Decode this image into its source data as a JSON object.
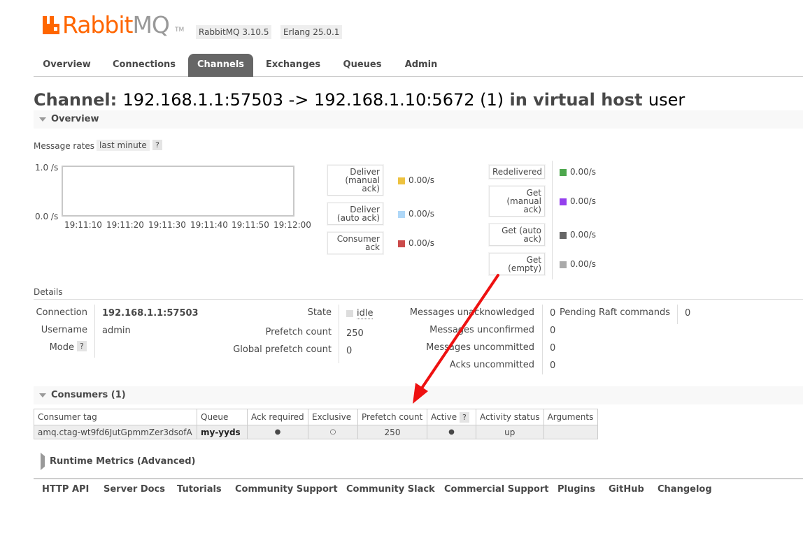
{
  "header": {
    "logo_text_rabbit": "Rabbit",
    "logo_text_mq": "MQ",
    "logo_tm": "TM",
    "rabbitmq_version": "RabbitMQ 3.10.5",
    "erlang_version": "Erlang 25.0.1",
    "brand_color": "#ff6600"
  },
  "tabs": [
    {
      "label": "Overview"
    },
    {
      "label": "Connections"
    },
    {
      "label": "Channels",
      "active": true
    },
    {
      "label": "Exchanges"
    },
    {
      "label": "Queues"
    },
    {
      "label": "Admin"
    }
  ],
  "title": {
    "prefix": "Channel: ",
    "channel": "192.168.1.1:57503 -> 192.168.1.10:5672 (1)",
    "middle": " in virtual host ",
    "vhost": "user"
  },
  "overview": {
    "heading": "Overview",
    "rates_label": "Message rates",
    "rates_window": "last minute",
    "help": "?",
    "chart": {
      "y_ticks": [
        "1.0 /s",
        "0.0 /s"
      ],
      "x_ticks": [
        "19:11:10",
        "19:11:20",
        "19:11:30",
        "19:11:40",
        "19:11:50",
        "19:12:00"
      ]
    },
    "rates_left": [
      {
        "label_lines": [
          "Deliver",
          "(manual",
          "ack)"
        ],
        "value": "0.00/s",
        "color": "#edc240"
      },
      {
        "label_lines": [
          "Deliver",
          "(auto ack)"
        ],
        "value": "0.00/s",
        "color": "#afd8f8"
      },
      {
        "label_lines": [
          "Consumer",
          "ack"
        ],
        "value": "0.00/s",
        "color": "#cb4b4b"
      }
    ],
    "rates_right": [
      {
        "label_lines": [
          "Redelivered"
        ],
        "value": "0.00/s",
        "color": "#4da74d"
      },
      {
        "label_lines": [
          "Get",
          "(manual",
          "ack)"
        ],
        "value": "0.00/s",
        "color": "#9440ed"
      },
      {
        "label_lines": [
          "Get (auto",
          "ack)"
        ],
        "value": "0.00/s",
        "color": "#666666"
      },
      {
        "label_lines": [
          "Get",
          "(empty)"
        ],
        "value": "0.00/s",
        "color": "#aaaaaa"
      }
    ]
  },
  "details": {
    "heading": "Details",
    "connection_label": "Connection",
    "connection_value": "192.168.1.1:57503",
    "username_label": "Username",
    "username_value": "admin",
    "mode_label": "Mode",
    "mode_help": "?",
    "state_label": "State",
    "state_value": "idle",
    "prefetch_label": "Prefetch count",
    "prefetch_value": "250",
    "global_prefetch_label": "Global prefetch count",
    "global_prefetch_value": "0",
    "unacked_label": "Messages unacknowledged",
    "unacked_value": "0",
    "unconfirmed_label": "Messages unconfirmed",
    "unconfirmed_value": "0",
    "uncommitted_label": "Messages uncommitted",
    "uncommitted_value": "0",
    "acks_uncommitted_label": "Acks uncommitted",
    "acks_uncommitted_value": "0",
    "raft_label": "Pending Raft commands",
    "raft_value": "0"
  },
  "consumers": {
    "heading": "Consumers (1)",
    "columns": [
      "Consumer tag",
      "Queue",
      "Ack required",
      "Exclusive",
      "Prefetch count",
      "Active",
      "Activity status",
      "Arguments"
    ],
    "active_help": "?",
    "row": {
      "tag": "amq.ctag-wt9fd6JutGpmmZer3dsofA",
      "queue": "my-yyds",
      "ack_required": "●",
      "exclusive": "○",
      "prefetch": "250",
      "active": "●",
      "status": "up",
      "arguments": ""
    }
  },
  "runtime_metrics": {
    "heading": "Runtime Metrics (Advanced)"
  },
  "footer": [
    "HTTP API",
    "Server Docs",
    "Tutorials",
    "Community Support",
    "Community Slack",
    "Commercial Support",
    "Plugins",
    "GitHub",
    "Changelog"
  ],
  "annotation": {
    "arrow_color": "#ee1111"
  }
}
